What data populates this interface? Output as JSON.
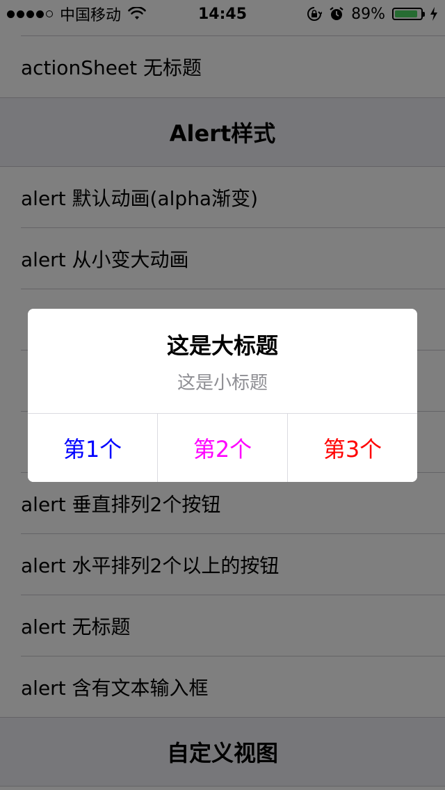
{
  "status_bar": {
    "carrier": "中国移动",
    "time": "14:45",
    "battery": "89%",
    "battery_level": 0.89,
    "icons": [
      "signal-dots",
      "wifi-icon",
      "rotation-lock-icon",
      "alarm-clock-icon",
      "battery-icon",
      "charging-bolt-icon"
    ]
  },
  "table": {
    "rows_top": [
      {
        "label": "actionSheet 无标题"
      }
    ],
    "section_alert": {
      "title": "Alert样式"
    },
    "rows_alert": [
      {
        "label": "alert 默认动画(alpha渐变)"
      },
      {
        "label": "alert 从小变大动画"
      },
      {
        "label": "alert 垂直排列2个按钮"
      },
      {
        "label": "alert 水平排列2个以上的按钮"
      },
      {
        "label": "alert 无标题"
      },
      {
        "label": "alert 含有文本输入框"
      }
    ],
    "section_custom": {
      "title": "自定义视图"
    }
  },
  "alert": {
    "title": "这是大标题",
    "subtitle": "这是小标题",
    "buttons": [
      {
        "label": "第1个",
        "color": "#0000ff"
      },
      {
        "label": "第2个",
        "color": "#ff00ff"
      },
      {
        "label": "第3个",
        "color": "#ff0000"
      }
    ]
  },
  "colors": {
    "separator": "#c8c7cc",
    "section_bg": "#efeff4",
    "overlay": "rgba(0,0,0,0.5)",
    "battery_fill": "#4cd964"
  }
}
